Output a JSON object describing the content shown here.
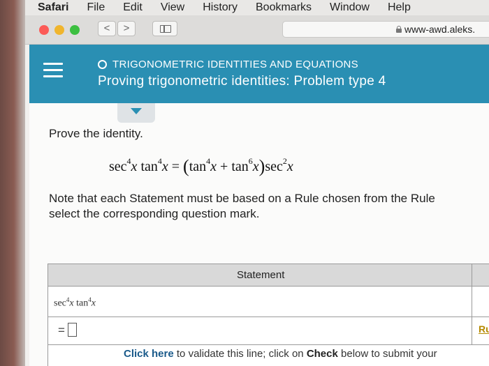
{
  "menubar": {
    "items": [
      "Safari",
      "File",
      "Edit",
      "View",
      "History",
      "Bookmarks",
      "Window",
      "Help"
    ]
  },
  "toolbar": {
    "back": "<",
    "forward": ">",
    "url": "www-awd.aleks."
  },
  "header": {
    "topic": "TRIGONOMETRIC IDENTITIES AND EQUATIONS",
    "title": "Proving trigonometric identities: Problem type 4"
  },
  "problem": {
    "prompt": "Prove the identity.",
    "note_line1": "Note that each Statement must be based on a Rule chosen from the Rule",
    "note_line2": "select the corresponding question mark."
  },
  "table": {
    "header": "Statement",
    "equals": "=",
    "rule_link": "Ru",
    "validate_link": "Click here",
    "validate_text1": " to validate this line; click on ",
    "validate_check": "Check",
    "validate_text2": " below to submit your"
  },
  "colors": {
    "header_bg": "#2a8fb3",
    "rule_link": "#b58a00"
  }
}
